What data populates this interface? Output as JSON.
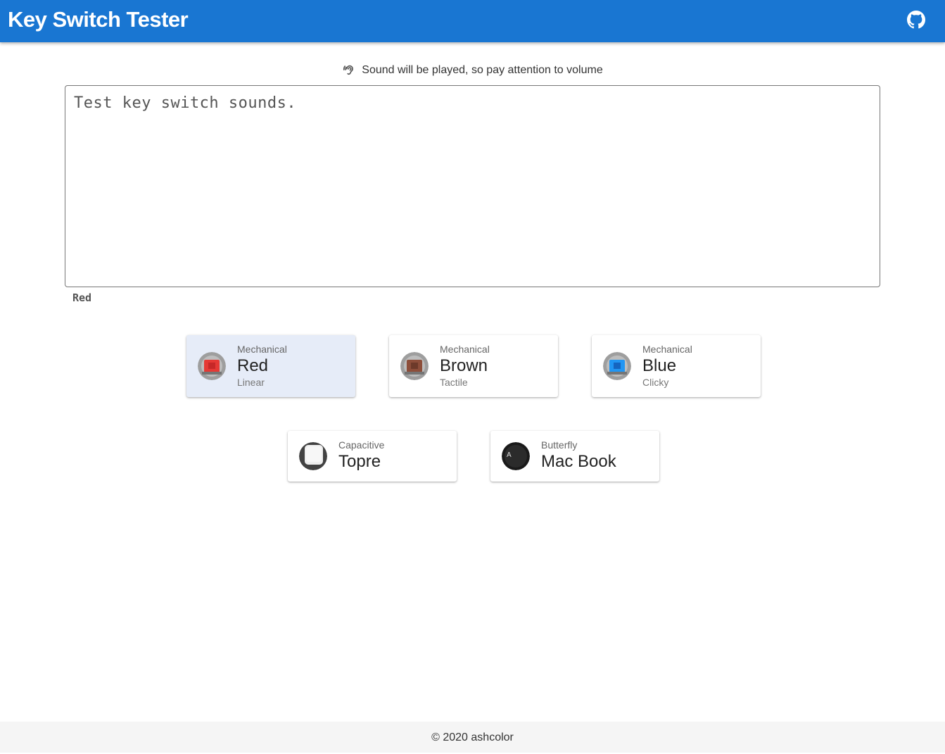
{
  "app": {
    "title": "Key Switch Tester"
  },
  "notice": {
    "text": "Sound will be played, so pay attention to volume"
  },
  "editor": {
    "placeholder": "Test key switch sounds.",
    "value": ""
  },
  "selected_switch_label": "Red",
  "switches": [
    {
      "kind": "Mechanical",
      "name": "Red",
      "feel": "Linear",
      "color": "#e53935",
      "selected": true
    },
    {
      "kind": "Mechanical",
      "name": "Brown",
      "feel": "Tactile",
      "color": "#8d4e3a",
      "selected": false
    },
    {
      "kind": "Mechanical",
      "name": "Blue",
      "feel": "Clicky",
      "color": "#2196f3",
      "selected": false
    },
    {
      "kind": "Capacitive",
      "name": "Topre",
      "feel": "",
      "color": "#e0e0e0",
      "selected": false
    },
    {
      "kind": "Butterfly",
      "name": "Mac Book",
      "feel": "",
      "color": "#222222",
      "selected": false
    }
  ],
  "icons": {
    "github": "github-icon",
    "ear": "hearing-icon"
  },
  "colors": {
    "appbar": "#1976d2",
    "selected_card": "#e6ecf8"
  },
  "footer": {
    "text": "© 2020 ashcolor"
  },
  "macbook_key_letter": "A"
}
